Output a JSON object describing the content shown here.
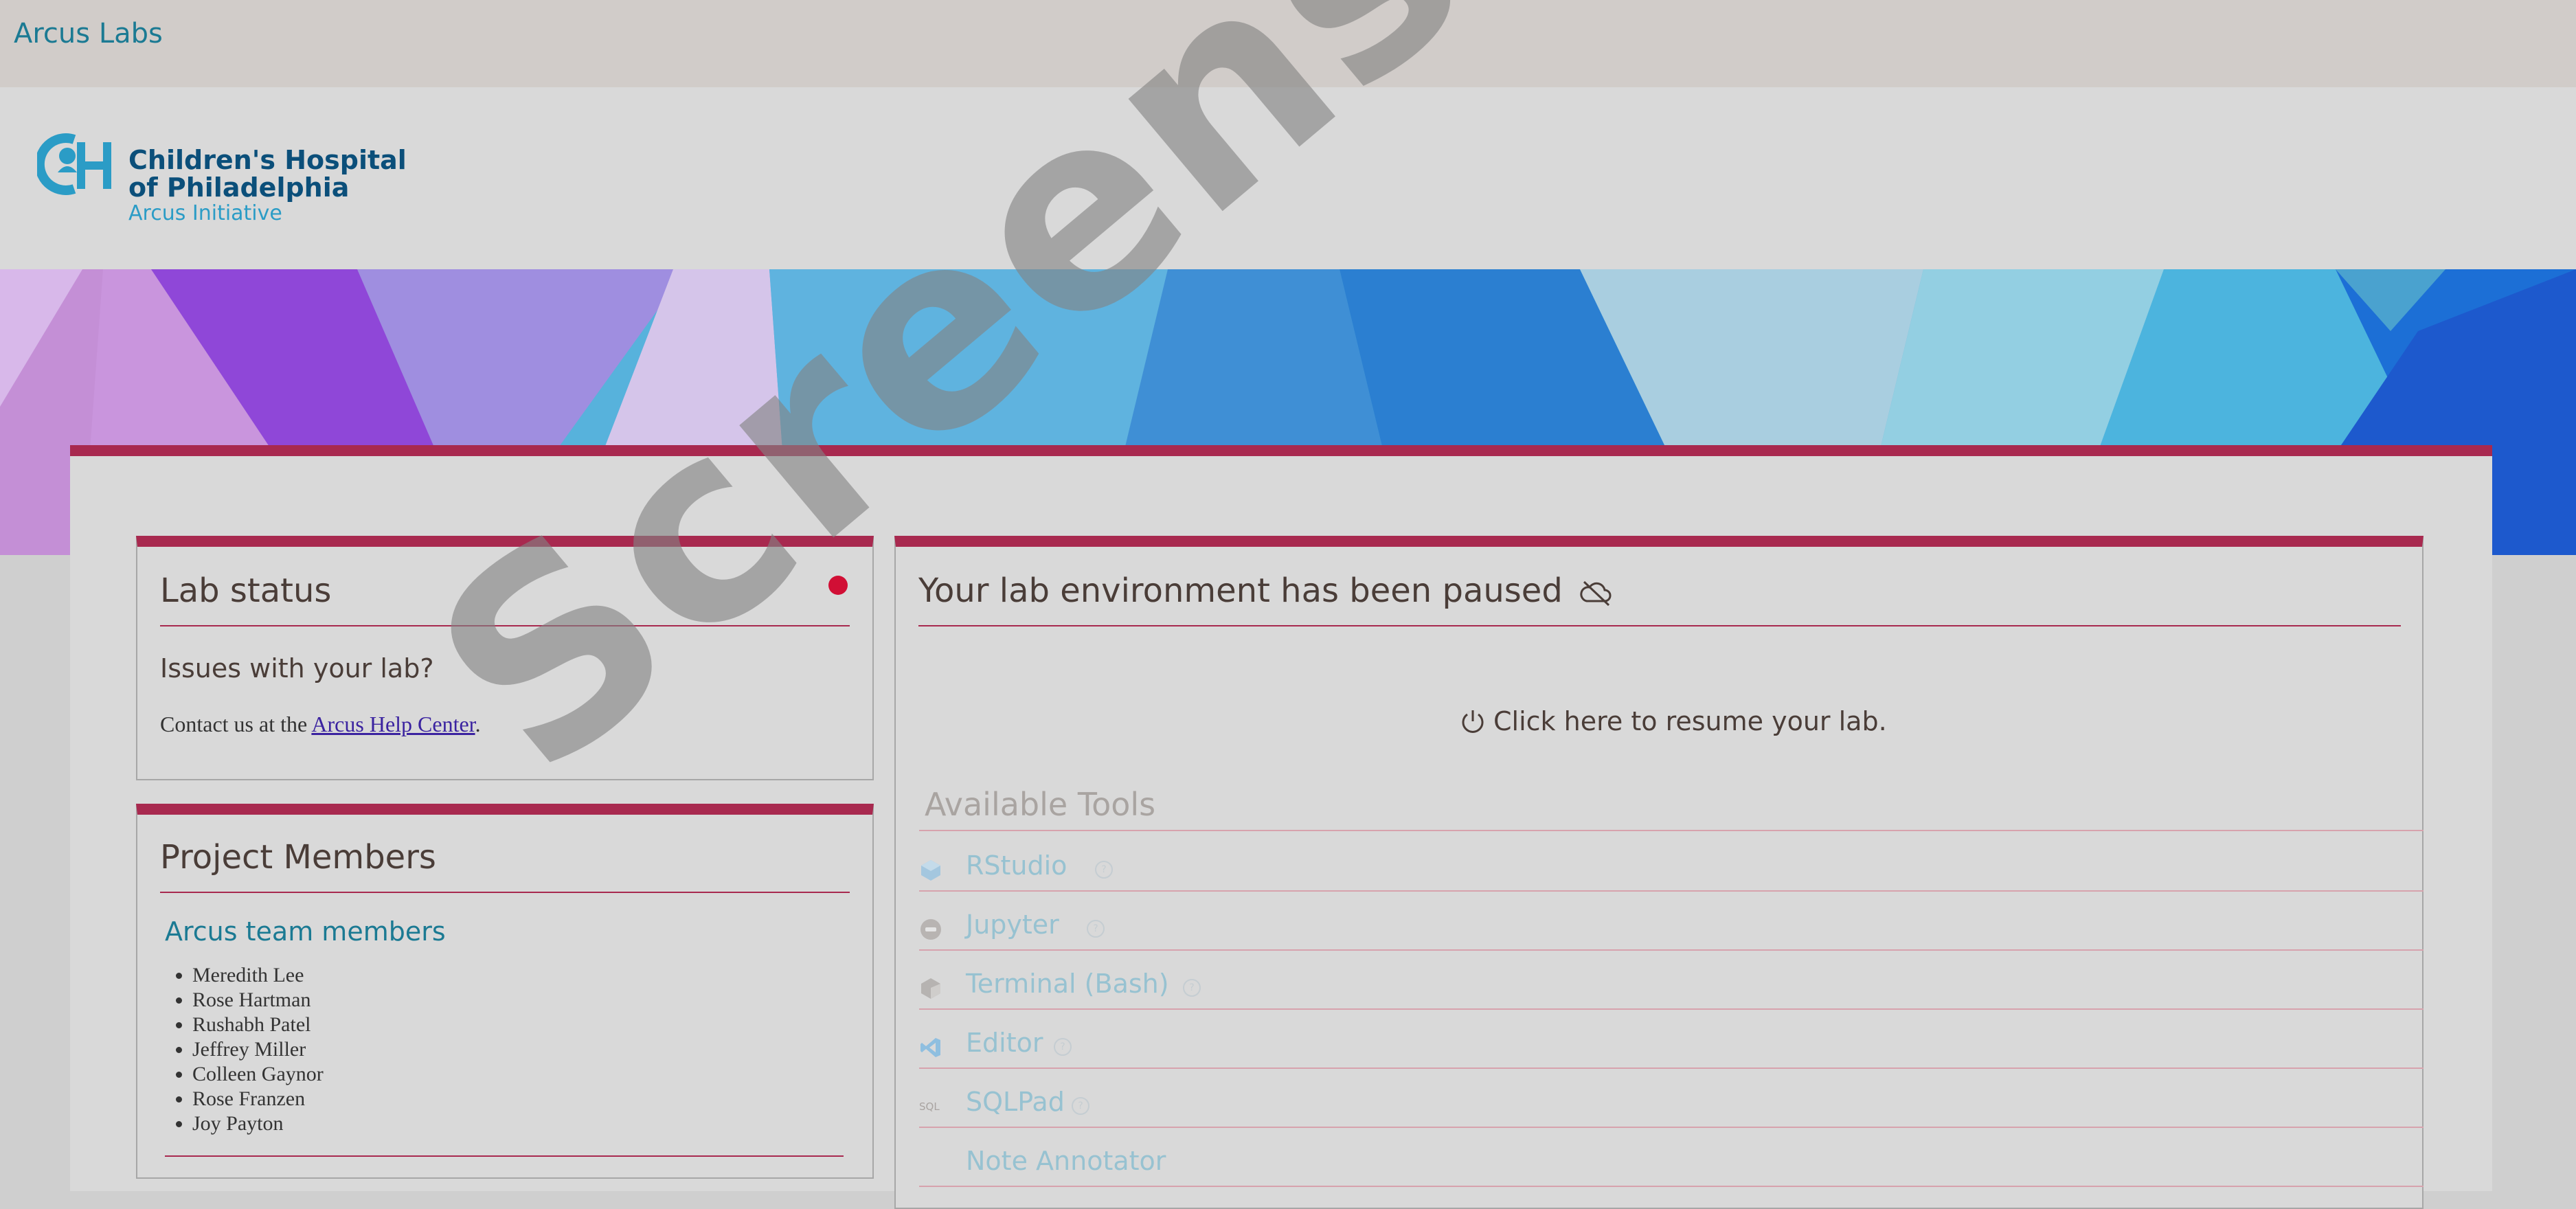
{
  "topbar": {
    "brand": "Arcus Labs"
  },
  "logo": {
    "line1": "Children's Hospital",
    "line2": "of Philadelphia",
    "line3": "Arcus Initiative"
  },
  "lab_status": {
    "title": "Lab status",
    "issues_heading": "Issues with your lab?",
    "contact_prefix": "Contact us at the ",
    "help_link": "Arcus Help Center",
    "contact_suffix": ".",
    "status_color": "#d10f35"
  },
  "project_members": {
    "title": "Project Members",
    "subtitle": "Arcus team members",
    "members": [
      "Meredith Lee",
      "Rose Hartman",
      "Rushabh Patel",
      "Jeffrey Miller",
      "Colleen Gaynor",
      "Rose Franzen",
      "Joy Payton"
    ]
  },
  "environment": {
    "title": "Your lab environment has been paused",
    "resume": "Click here to resume your lab.",
    "tools_heading": "Available Tools",
    "tools": [
      {
        "name": "RStudio",
        "icon": "rstudio-icon",
        "help": "?"
      },
      {
        "name": "Jupyter",
        "icon": "jupyter-icon",
        "help": "?"
      },
      {
        "name": "Terminal (Bash)",
        "icon": "terminal-icon",
        "help": "?"
      },
      {
        "name": "Editor",
        "icon": "vscode-icon",
        "help": "?"
      },
      {
        "name": "SQLPad",
        "icon": "sql-icon",
        "icon_label": "SQL",
        "help": "?"
      },
      {
        "name": "Note Annotator",
        "icon": "",
        "help": ""
      }
    ]
  },
  "watermark": "Screenshot",
  "colors": {
    "accent": "#a8294f",
    "link": "#1b7a93",
    "status": "#d10f35"
  }
}
